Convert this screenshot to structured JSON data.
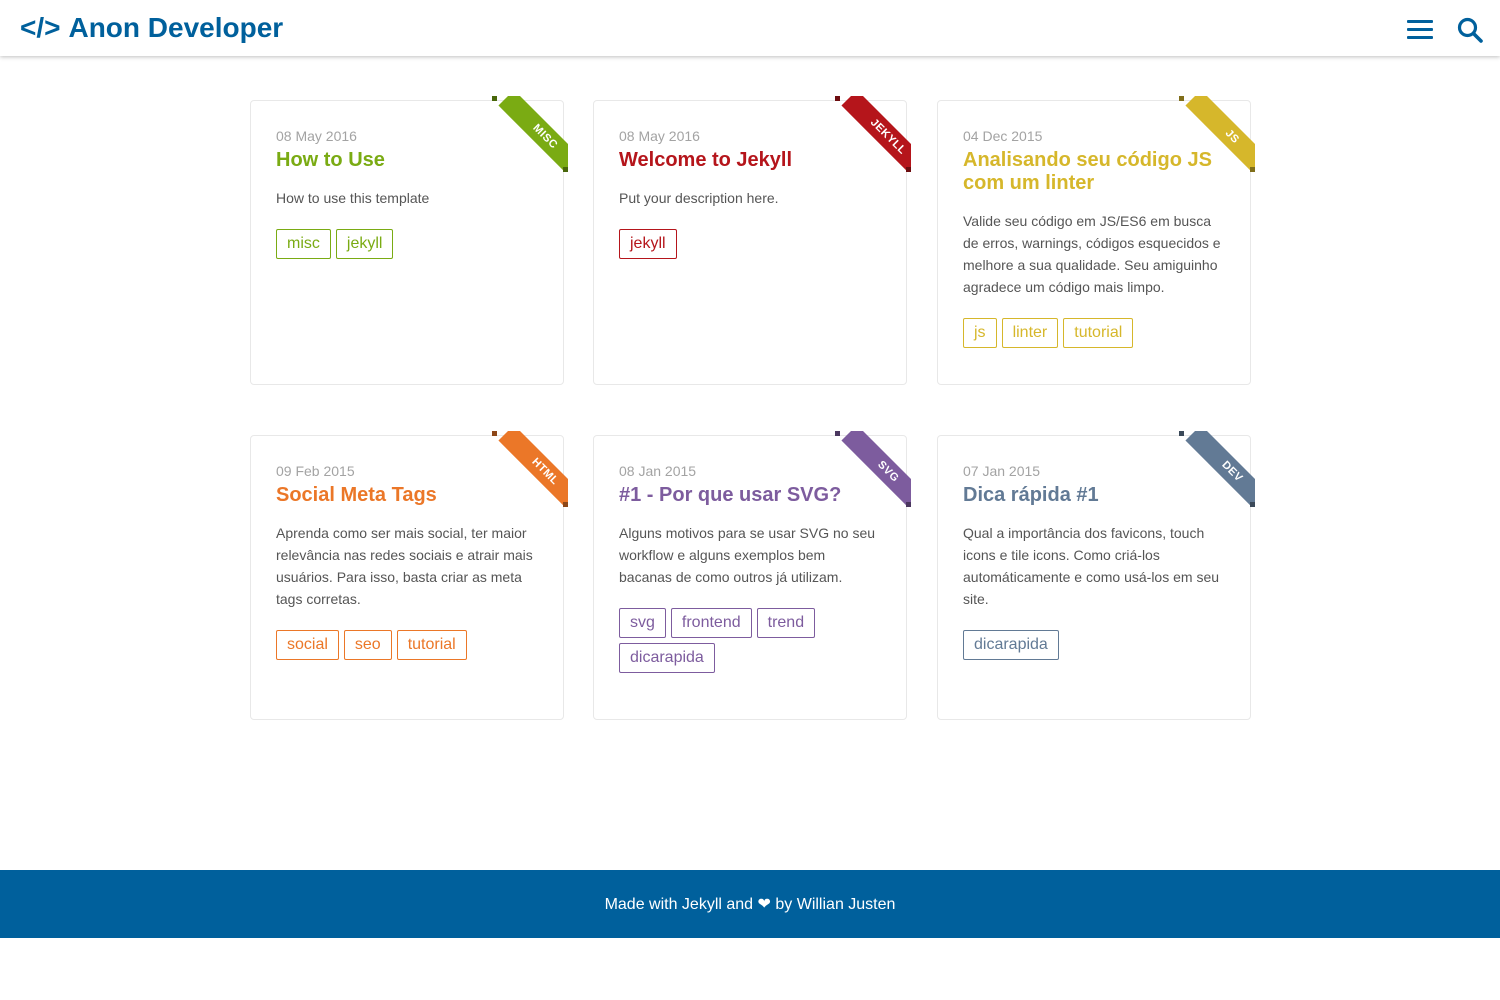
{
  "header": {
    "logo_code": "</>",
    "logo_text": "Anon Developer",
    "menu_icon": "hamburger-menu-icon",
    "search_icon": "search-icon",
    "accent": "#00609c"
  },
  "posts": [
    {
      "category": "MISC",
      "color": "#7aab13",
      "date": "08 May 2016",
      "title": "How to Use",
      "description": "How to use this template",
      "tags": [
        "misc",
        "jekyll"
      ]
    },
    {
      "category": "JEKYLL",
      "color": "#b5151b",
      "date": "08 May 2016",
      "title": "Welcome to Jekyll",
      "description": "Put your description here.",
      "tags": [
        "jekyll"
      ]
    },
    {
      "category": "JS",
      "color": "#d6b72b",
      "date": "04 Dec 2015",
      "title": "Analisando seu código JS com um linter",
      "description": "Valide seu código em JS/ES6 em busca de erros, warnings, códigos esquecidos e melhore a sua qualidade. Seu amiguinho agradece um código mais limpo.",
      "tags": [
        "js",
        "linter",
        "tutorial"
      ]
    },
    {
      "category": "HTML",
      "color": "#eb7728",
      "date": "09 Feb 2015",
      "title": "Social Meta Tags",
      "description": "Aprenda como ser mais social, ter maior relevância nas redes sociais e atrair mais usuários. Para isso, basta criar as meta tags corretas.",
      "tags": [
        "social",
        "seo",
        "tutorial"
      ]
    },
    {
      "category": "SVG",
      "color": "#7d5c9e",
      "date": "08 Jan 2015",
      "title": "#1 - Por que usar SVG?",
      "description": "Alguns motivos para se usar SVG no seu workflow e alguns exemplos bem bacanas de como outros já utilizam.",
      "tags": [
        "svg",
        "frontend",
        "trend",
        "dicarapida"
      ]
    },
    {
      "category": "DEV",
      "color": "#627a95",
      "date": "07 Jan 2015",
      "title": "Dica rápida #1",
      "description": "Qual a importância dos favicons, touch icons e tile icons. Como criá-los automáticamente e como usá-los em seu site.",
      "tags": [
        "dicarapida"
      ]
    }
  ],
  "footer": {
    "text": "Made with Jekyll and ❤ by Willian Justen",
    "background": "#00609c"
  }
}
